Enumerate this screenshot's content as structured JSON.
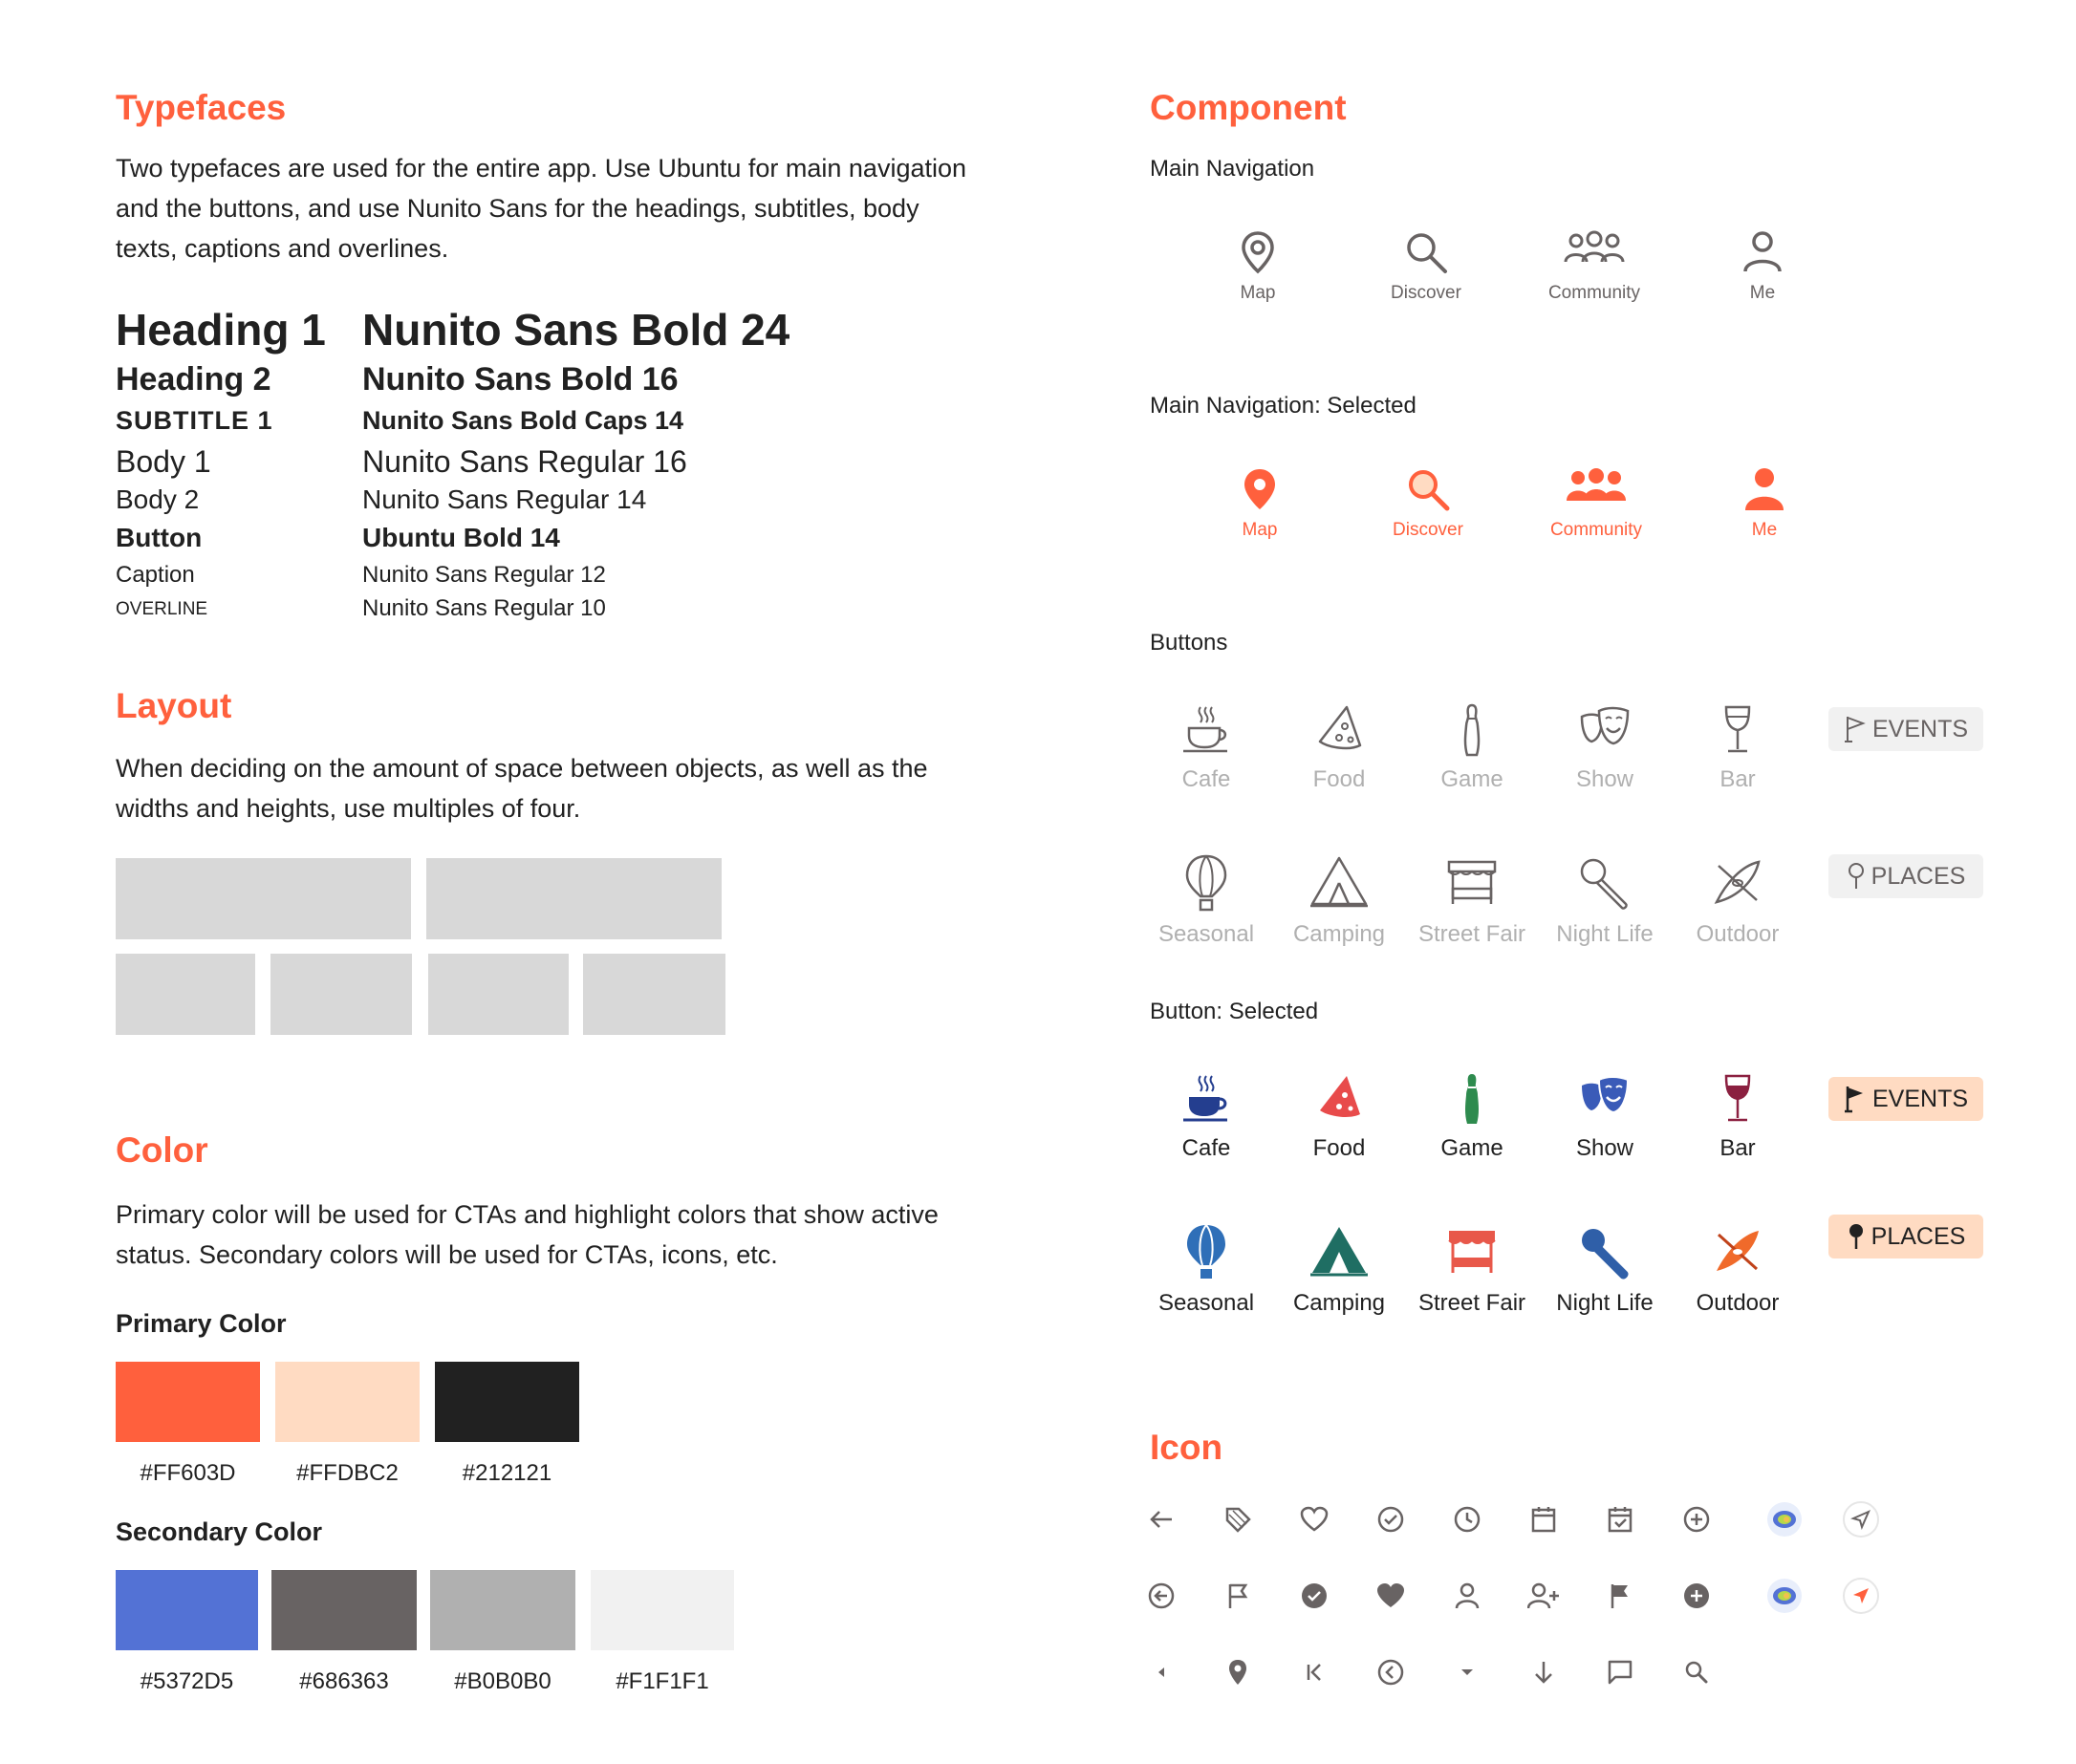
{
  "typefaces": {
    "title": "Typefaces",
    "line1": "Two typefaces are used for the entire app. Use Ubuntu for main navigation",
    "line2": "and the buttons, and use Nunito Sans for the headings, subtitles, body",
    "line3": "texts, captions and overlines.",
    "rows": [
      {
        "name": "Heading 1",
        "spec": "Nunito Sans Bold 24"
      },
      {
        "name": "Heading 2",
        "spec": "Nunito Sans Bold 16"
      },
      {
        "name": "SUBTITLE 1",
        "spec": "Nunito Sans Bold Caps 14"
      },
      {
        "name": "Body 1",
        "spec": "Nunito Sans Regular 16"
      },
      {
        "name": "Body 2",
        "spec": "Nunito Sans Regular 14"
      },
      {
        "name": "Button",
        "spec": "Ubuntu Bold 14"
      },
      {
        "name": "Caption",
        "spec": "Nunito Sans Regular 12"
      },
      {
        "name": "OVERLINE",
        "spec": "Nunito Sans Regular 10"
      }
    ]
  },
  "layout": {
    "title": "Layout",
    "line1": "When deciding on the amount of space between objects, as well as the",
    "line2": "widths and heights, use multiples of four."
  },
  "color": {
    "title": "Color",
    "line1": "Primary color will be used for CTAs and highlight colors that show active",
    "line2": "status. Secondary colors will be used for CTAs, icons, etc.",
    "primary_title": "Primary Color",
    "primary": [
      "#FF603D",
      "#FFDBC2",
      "#212121"
    ],
    "secondary_title": "Secondary Color",
    "secondary": [
      "#5372D5",
      "#686363",
      "#B0B0B0",
      "#F1F1F1"
    ]
  },
  "component": {
    "title": "Component",
    "main_nav_title": "Main Navigation",
    "main_nav_selected_title": "Main Navigation: Selected",
    "nav": [
      "Map",
      "Discover",
      "Community",
      "Me"
    ],
    "buttons_title": "Buttons",
    "button_selected_title": "Button: Selected",
    "row1": [
      "Cafe",
      "Food",
      "Game",
      "Show",
      "Bar"
    ],
    "row2": [
      "Seasonal",
      "Camping",
      "Street Fair",
      "Night Life",
      "Outdoor"
    ],
    "events": "EVENTS",
    "places": "PLACES"
  },
  "icon": {
    "title": "Icon",
    "row1": [
      "arrow-left-icon",
      "tag-icon",
      "heart-outline-icon",
      "check-circle-outline-icon",
      "clock-icon",
      "calendar-icon",
      "calendar-check-icon",
      "plus-circle-outline-icon",
      "user-location-icon",
      "navigation-outline-icon"
    ],
    "row2": [
      "arrow-left-circle-icon",
      "flag-outline-icon",
      "check-circle-filled-icon",
      "heart-filled-icon",
      "person-icon",
      "person-add-icon",
      "flag-filled-icon",
      "plus-circle-filled-icon",
      "user-location-icon",
      "navigation-filled-icon"
    ],
    "row3": [
      "caret-left-icon",
      "pin-filled-icon",
      "skip-back-icon",
      "chevron-left-circle-icon",
      "caret-down-icon",
      "arrow-down-icon",
      "chat-icon",
      "search-icon"
    ]
  },
  "colors": {
    "primary": "#FF603D",
    "muted": "#B0B0B0",
    "dark": "#686363"
  }
}
